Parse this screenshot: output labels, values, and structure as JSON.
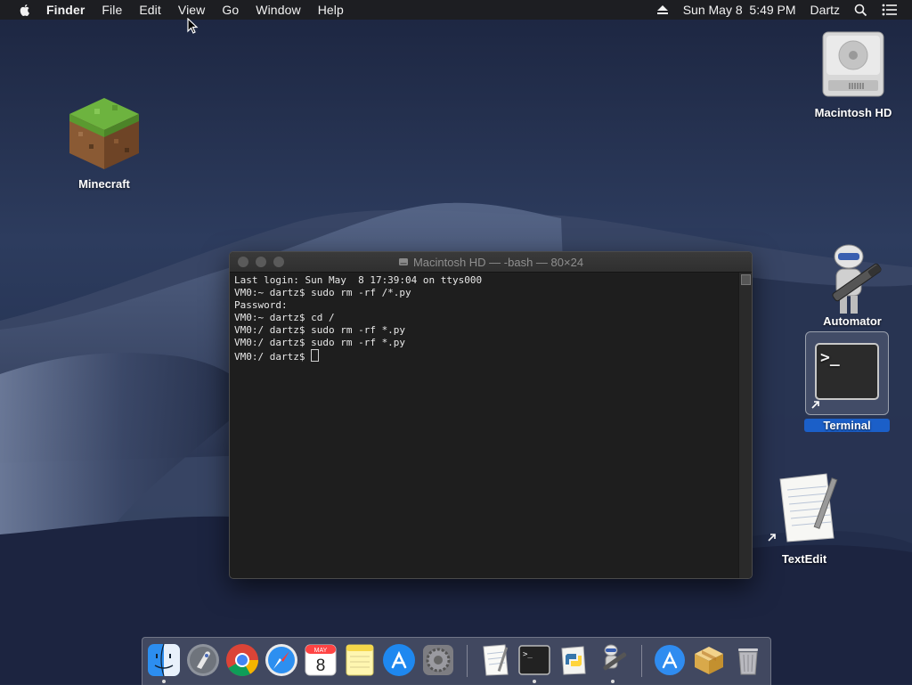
{
  "menubar": {
    "app_name": "Finder",
    "items": [
      "File",
      "Edit",
      "View",
      "Go",
      "Window",
      "Help"
    ],
    "clock": "Sun May 8  5:49 PM",
    "user": "Dartz"
  },
  "desktop": {
    "icons": {
      "minecraft": "Minecraft",
      "macintosh_hd": "Macintosh HD",
      "automator": "Automator",
      "terminal": "Terminal",
      "textedit": "TextEdit"
    }
  },
  "terminal": {
    "title": "Macintosh HD — -bash — 80×24",
    "lines": [
      "Last login: Sun May  8 17:39:04 on ttys000",
      "VM0:~ dartz$ sudo rm -rf /*.py",
      "Password:",
      "VM0:~ dartz$ cd /",
      "VM0:/ dartz$ sudo rm -rf *.py",
      "VM0:/ dartz$ sudo rm -rf *.py",
      "VM0:/ dartz$ "
    ]
  },
  "dock": {
    "apps": [
      "finder-icon",
      "launchpad-icon",
      "chrome-icon",
      "safari-icon",
      "calendar-icon",
      "notes-icon",
      "app-store-icon",
      "system-preferences-icon",
      "textedit-icon",
      "terminal-icon",
      "python-launcher-icon",
      "automator-icon",
      "applications-folder-icon",
      "installer-package-icon",
      "trash-icon"
    ],
    "calendar_month": "MAY",
    "calendar_day": "8"
  }
}
